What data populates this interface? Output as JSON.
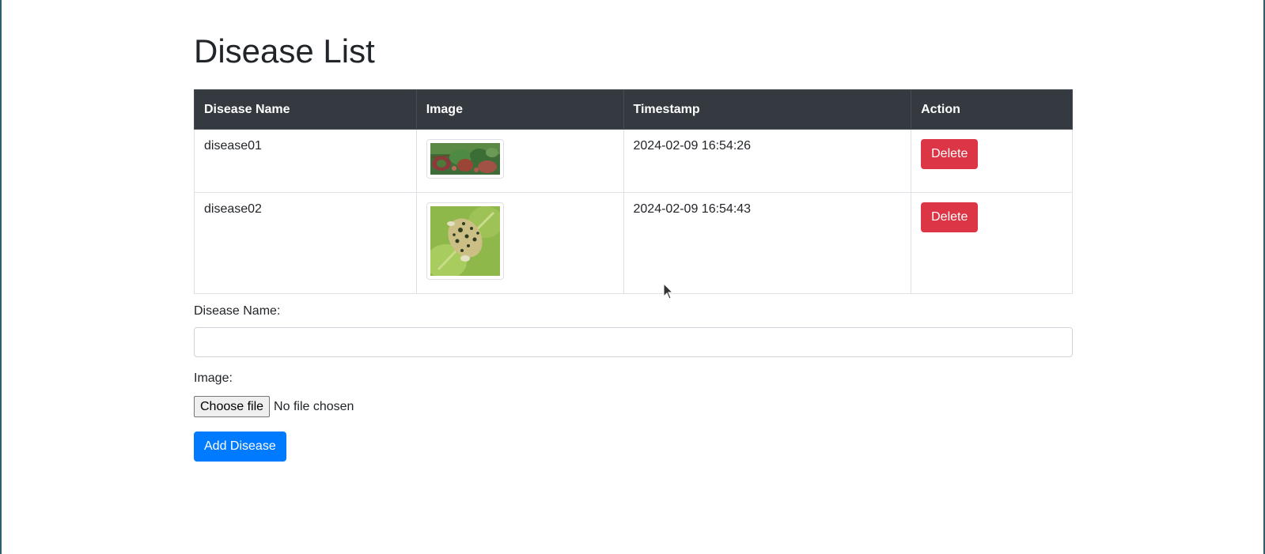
{
  "page": {
    "title": "Disease List"
  },
  "table": {
    "headers": [
      "Disease Name",
      "Image",
      "Timestamp",
      "Action"
    ],
    "rows": [
      {
        "name": "disease01",
        "image_icon": "leaf-photo-thumbnail",
        "timestamp": "2024-02-09 16:54:26",
        "action_label": "Delete"
      },
      {
        "name": "disease02",
        "image_icon": "leaf-photo-thumbnail",
        "timestamp": "2024-02-09 16:54:43",
        "action_label": "Delete"
      }
    ]
  },
  "form": {
    "name_label": "Disease Name:",
    "name_value": "",
    "image_label": "Image:",
    "file_button_label": "Choose file",
    "file_status": "No file chosen",
    "submit_label": "Add Disease"
  },
  "colors": {
    "header_bg": "#343a40",
    "danger": "#dc3545",
    "primary": "#007bff"
  }
}
